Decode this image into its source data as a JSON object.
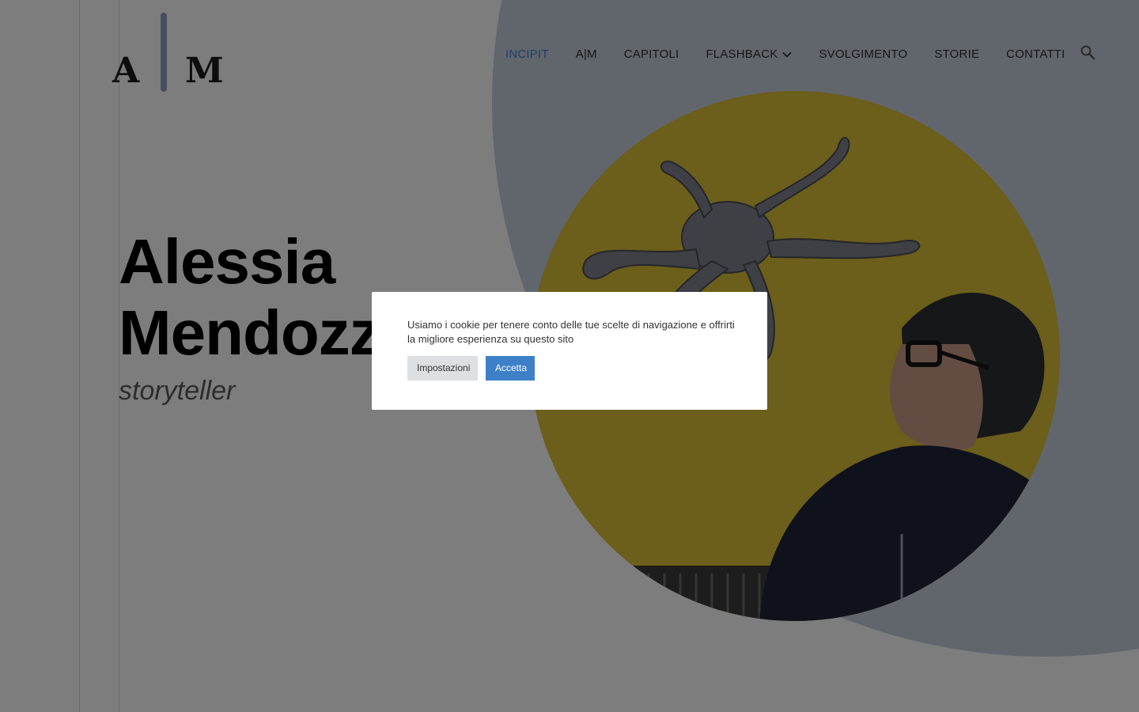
{
  "logo": {
    "letter_left": "A",
    "letter_right": "M",
    "bar_color": "#8a9fc4"
  },
  "nav": {
    "items": [
      {
        "label": "INCIPIT",
        "active": true
      },
      {
        "label": "A|M",
        "active": false
      },
      {
        "label": "CAPITOLI",
        "active": false
      },
      {
        "label": "FLASHBACK",
        "active": false,
        "has_dropdown": true
      },
      {
        "label": "SVOLGIMENTO",
        "active": false
      },
      {
        "label": "STORIE",
        "active": false
      },
      {
        "label": "CONTATTI",
        "active": false
      }
    ],
    "dropdown_icon": "chevron-down-icon",
    "search_icon": "search-icon",
    "active_color": "#3d80c8"
  },
  "hero": {
    "name_line1": "Alessia",
    "name_line2": "Mendozzi",
    "subtitle": "storyteller"
  },
  "photo": {
    "background_color": "#d8bc37"
  },
  "cookie_notice": {
    "text": "Usiamo i cookie per tenere conto delle tue scelte di navigazione e offrirti la migliore esperienza su questo sito",
    "settings_label": "Impostazioni",
    "accept_label": "Accetta",
    "accept_color": "#3d80c8"
  }
}
